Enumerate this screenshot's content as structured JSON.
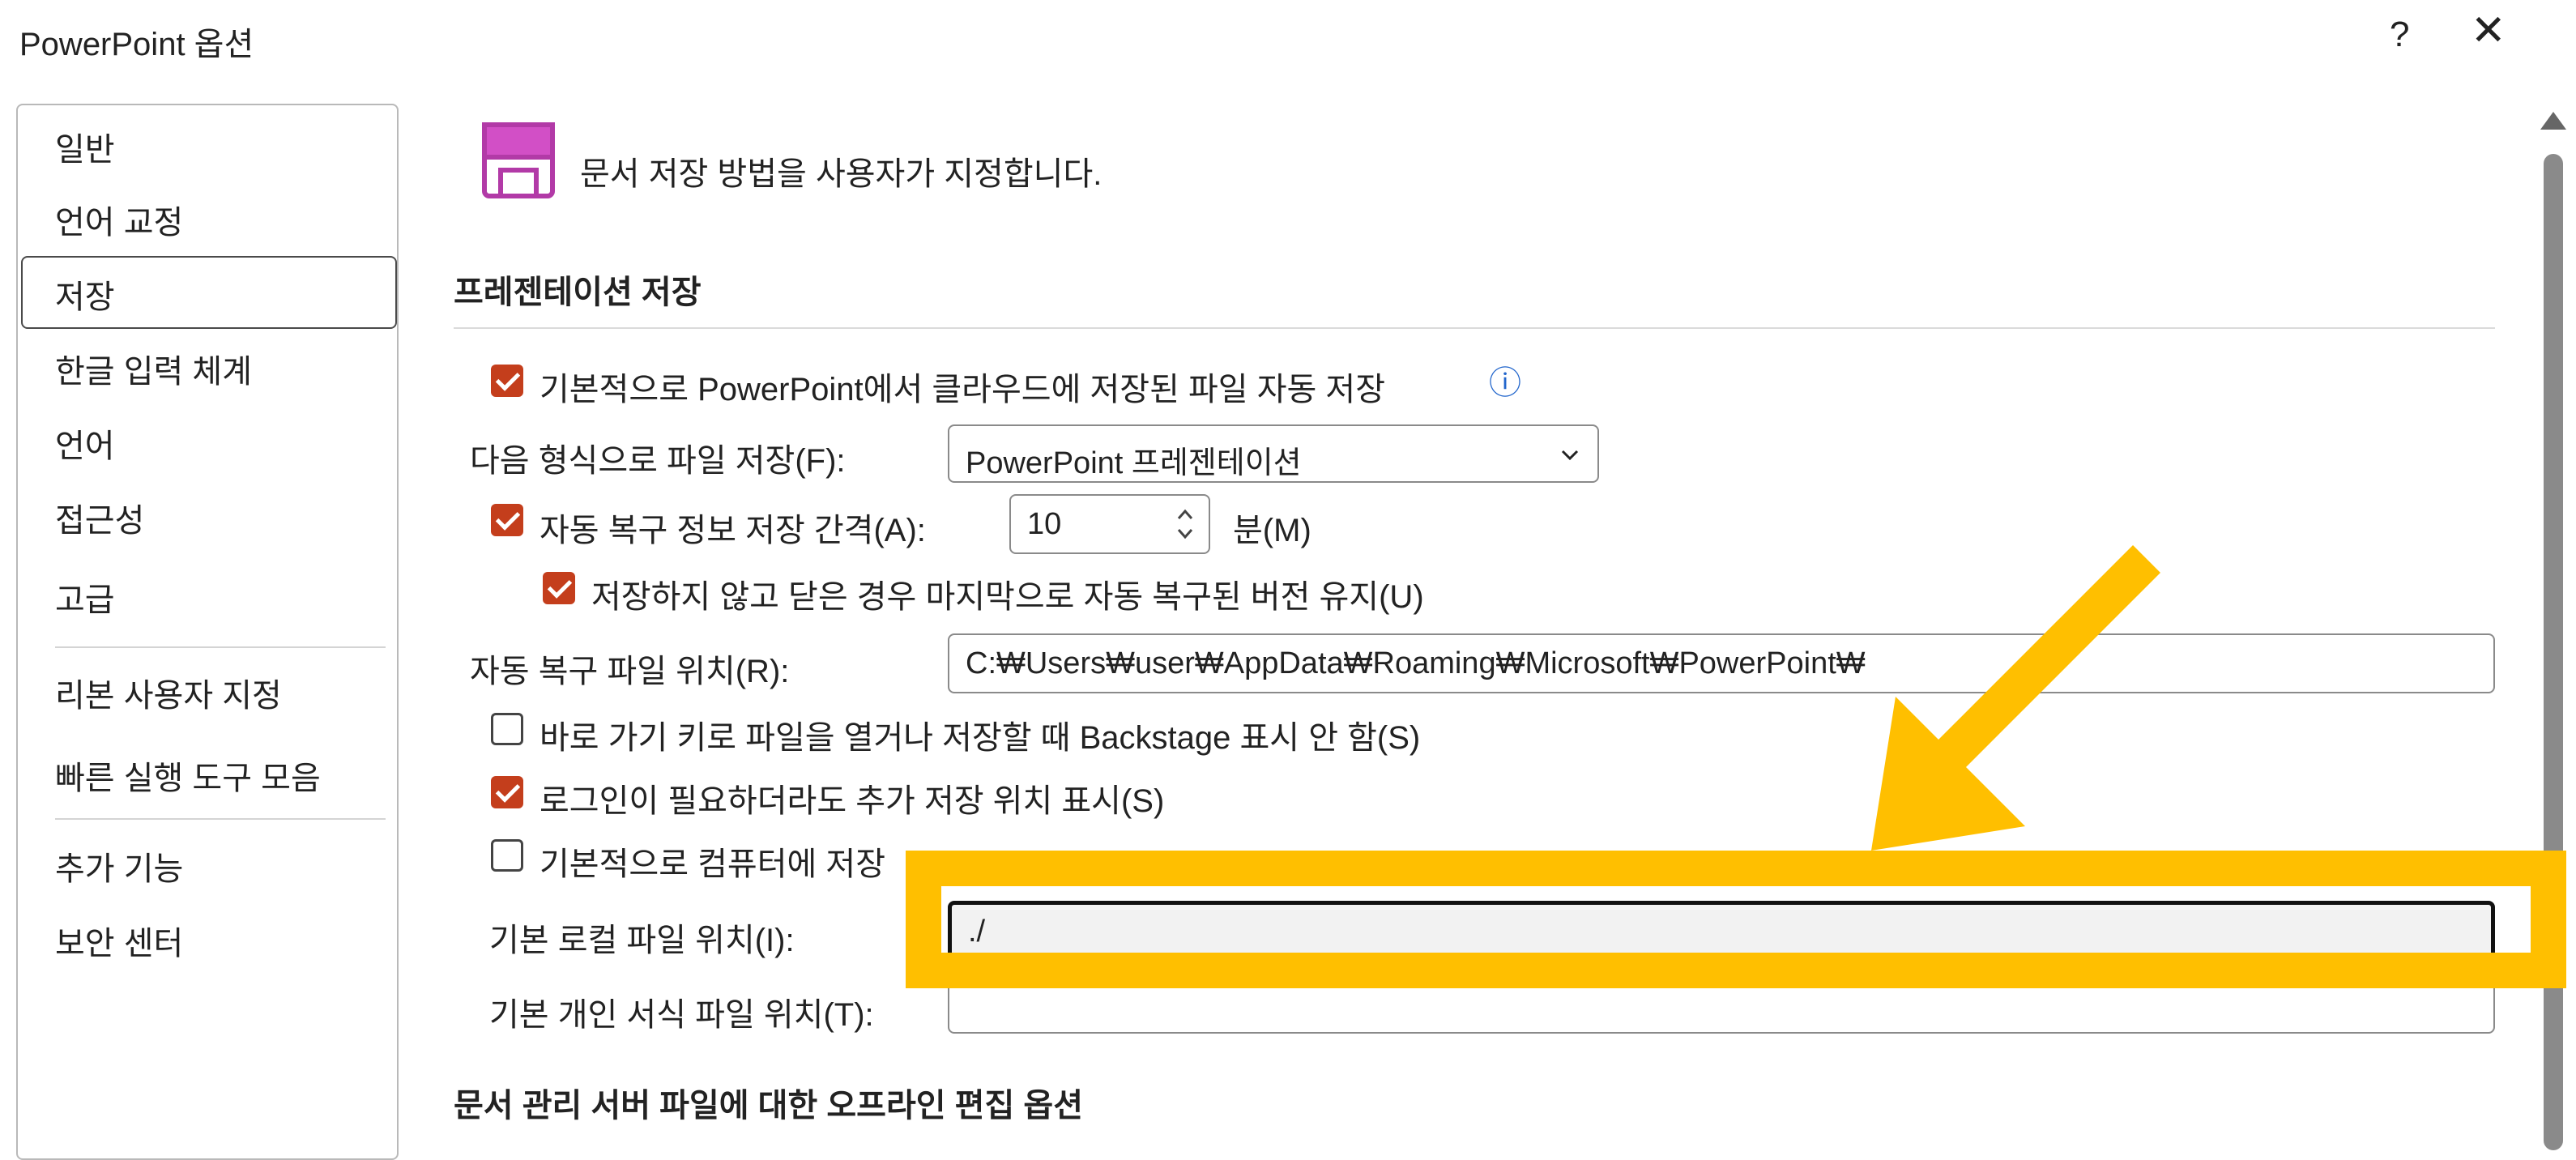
{
  "window": {
    "title": "PowerPoint 옵션",
    "help_label": "?",
    "close_label": "✕"
  },
  "sidebar": {
    "items": [
      {
        "label": "일반"
      },
      {
        "label": "언어 교정"
      },
      {
        "label": "저장"
      },
      {
        "label": "한글 입력 체계"
      },
      {
        "label": "언어"
      },
      {
        "label": "접근성"
      },
      {
        "label": "고급"
      },
      {
        "label": "리본 사용자 지정"
      },
      {
        "label": "빠른 실행 도구 모음"
      },
      {
        "label": "추가 기능"
      },
      {
        "label": "보안 센터"
      }
    ],
    "selected": "저장"
  },
  "main": {
    "header": "문서 저장 방법을 사용자가 지정합니다.",
    "section1_title": "프레젠테이션 저장",
    "autosave_cloud_label": "기본적으로 PowerPoint에서 클라우드에 저장된 파일 자동 저장",
    "info_icon": "ⓘ",
    "save_format_label": "다음 형식으로 파일 저장(F):",
    "save_format_value": "PowerPoint 프레젠테이션",
    "autorecover_label": "자동 복구 정보 저장 간격(A):",
    "autorecover_minutes": "10",
    "minutes_label": "분(M)",
    "keep_last_label": "저장하지 않고 닫은 경우 마지막으로 자동 복구된 버전 유지(U)",
    "autorecover_location_label": "자동 복구 파일 위치(R):",
    "autorecover_location_value": "C:₩Users₩user₩AppData₩Roaming₩Microsoft₩PowerPoint₩",
    "backstage_label": "바로 가기 키로 파일을 열거나 저장할 때 Backstage 표시 안 함(S)",
    "signin_label": "로그인이 필요하더라도 추가 저장 위치 표시(S)",
    "save_to_computer_label": "기본적으로 컴퓨터에 저장",
    "local_file_location_label": "기본 로컬 파일 위치(I):",
    "local_file_location_value": "./",
    "personal_templates_label": "기본 개인 서식 파일 위치(T):",
    "personal_templates_value": "",
    "section2_title": "문서 관리 서버 파일에 대한 오프라인 편집 옵션"
  },
  "colors": {
    "checkbox": "#c43e1c",
    "highlight": "#ffbf00",
    "save_icon": "#b23aa7"
  },
  "icons": {
    "save": "save-disk-icon",
    "info": "info-icon",
    "dropdown": "chevron-down-icon",
    "spinner": "spinner-arrows-icon",
    "close": "close-icon",
    "help": "help-icon"
  }
}
